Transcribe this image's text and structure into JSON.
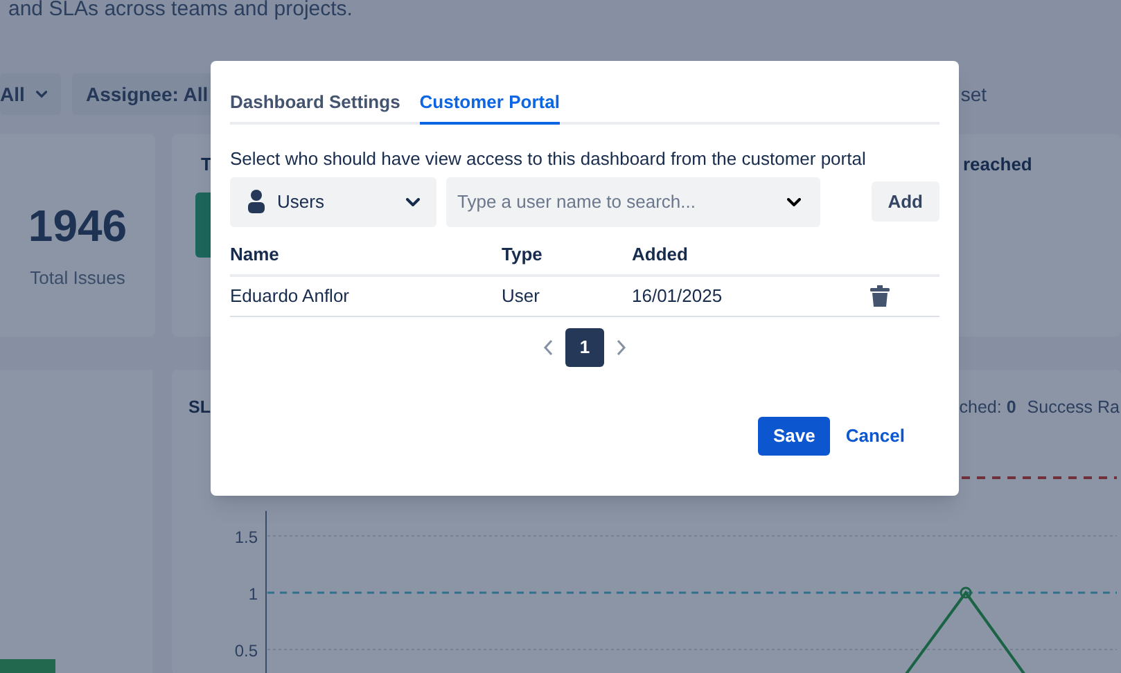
{
  "background": {
    "subtitle": "and SLAs across teams and projects.",
    "filters": [
      {
        "label": "All"
      },
      {
        "label": "Assignee: All"
      }
    ],
    "filter_action": "set",
    "stat": {
      "value": "1946",
      "label": "Total Issues"
    },
    "card_2_title": "T",
    "card_3_title": "reached",
    "chart_panel": {
      "title": "SL",
      "breached": "ched: **0**",
      "success": "Success Ra",
      "y_tick_labels": [
        "1.5",
        "1",
        "0.5"
      ]
    }
  },
  "dialog": {
    "tabs": [
      {
        "label": "Dashboard Settings",
        "selected": false
      },
      {
        "label": "Customer Portal",
        "selected": true
      }
    ],
    "description": "Select who should have view access to this dashboard from the customer portal",
    "type_select": {
      "value": "Users"
    },
    "search": {
      "placeholder": "Type a user name to search..."
    },
    "add_button": "Add",
    "table": {
      "columns": [
        "Name",
        "Type",
        "Added"
      ],
      "rows": [
        {
          "name": "Eduardo Anflor",
          "type": "User",
          "added": "16/01/2025"
        }
      ]
    },
    "pagination": {
      "pages": [
        {
          "label": "1",
          "selected": true
        }
      ]
    },
    "save_button": "Save",
    "cancel_button": "Cancel"
  }
}
